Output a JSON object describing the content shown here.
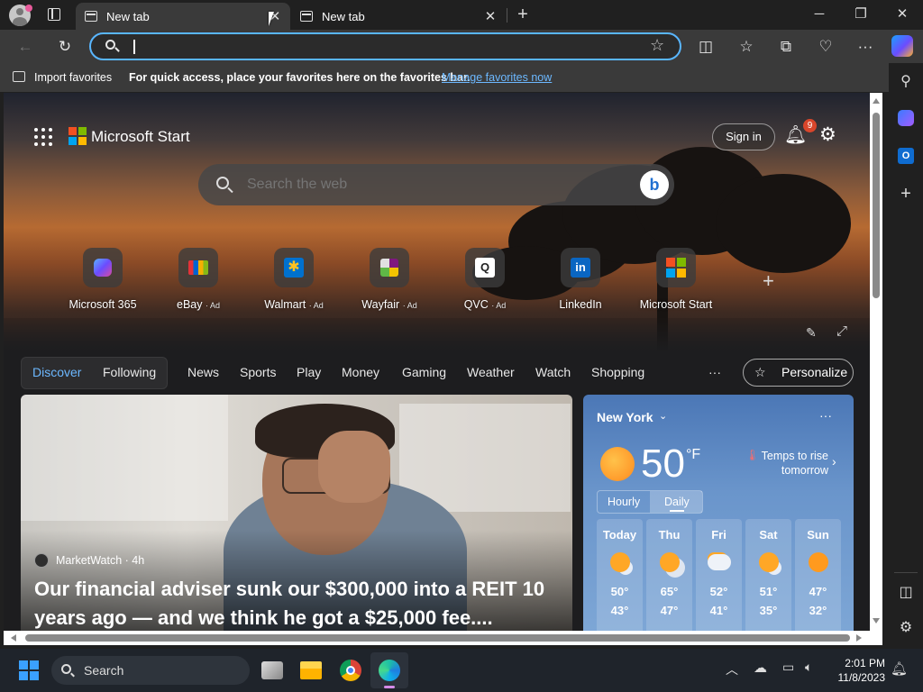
{
  "browser": {
    "tabs": [
      {
        "title": "New tab"
      },
      {
        "title": "New tab"
      }
    ],
    "address": {
      "value": "",
      "placeholder": ""
    },
    "favorites_bar": {
      "import_label": "Import favorites",
      "message": "For quick access, place your favorites here on the favorites bar.",
      "manage_link": "Manage favorites now"
    }
  },
  "start": {
    "brand": "Microsoft Start",
    "search_placeholder": "Search the web",
    "sign_in": "Sign in",
    "notification_count": "9",
    "quick_links": [
      {
        "label": "Microsoft 365",
        "ad": ""
      },
      {
        "label": "eBay",
        "ad": "· Ad"
      },
      {
        "label": "Walmart",
        "ad": "· Ad"
      },
      {
        "label": "Wayfair",
        "ad": "· Ad"
      },
      {
        "label": "QVC",
        "ad": "· Ad"
      },
      {
        "label": "LinkedIn",
        "ad": ""
      },
      {
        "label": "Microsoft Start",
        "ad": ""
      }
    ],
    "nav": {
      "discover": "Discover",
      "following": "Following",
      "items": [
        "News",
        "Sports",
        "Play",
        "Money",
        "Gaming",
        "Weather",
        "Watch",
        "Shopping"
      ],
      "more": "···",
      "personalize": "Personalize"
    },
    "news": {
      "source": "MarketWatch · 4h",
      "headline": "Our financial adviser sunk our $300,000 into a REIT 10 years ago — and we think he got a $25,000 fee...."
    },
    "weather": {
      "city": "New York",
      "temp": "50",
      "unit": "°F",
      "note": "Temps to rise tomorrow",
      "toggle": [
        "Hourly",
        "Daily"
      ],
      "days": [
        {
          "name": "Today",
          "hi": "50°",
          "lo": "43°",
          "icon": "partly-sunny"
        },
        {
          "name": "Thu",
          "hi": "65°",
          "lo": "47°",
          "icon": "partly-cloudy"
        },
        {
          "name": "Fri",
          "hi": "52°",
          "lo": "41°",
          "icon": "cloudy"
        },
        {
          "name": "Sat",
          "hi": "51°",
          "lo": "35°",
          "icon": "partly-sunny"
        },
        {
          "name": "Sun",
          "hi": "47°",
          "lo": "32°",
          "icon": "sunny"
        }
      ]
    }
  },
  "taskbar": {
    "search_label": "Search",
    "time": "2:01 PM",
    "date": "11/8/2023"
  }
}
